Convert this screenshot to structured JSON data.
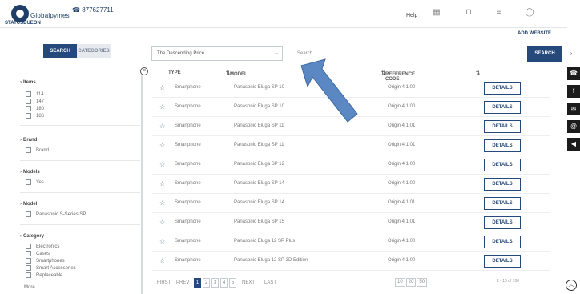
{
  "header": {
    "brand": "Globalpymes",
    "phone": "☎ 877627711",
    "breadcrumb": "STATUSBUEON",
    "help_label": "Help",
    "icons": [
      "grid-icon",
      "cart-icon",
      "bell-icon",
      "user-icon"
    ],
    "link_label": "ADD WEBSITE"
  },
  "tabs": [
    {
      "label": "SEARCH",
      "active": true
    },
    {
      "label": "CATEGORIES",
      "active": false
    }
  ],
  "toolbar": {
    "select_value": "The Descending Price",
    "search_value": "Search",
    "search_button": "SEARCH"
  },
  "sidebar": {
    "groups": [
      {
        "title": "Items",
        "options": [
          "114",
          "147",
          "180",
          "186"
        ]
      },
      {
        "title": "Brand",
        "options": [
          "Brand"
        ]
      },
      {
        "title": "Models",
        "options": [
          "Yes"
        ]
      },
      {
        "title": "Model",
        "options": [
          "Panasonic S-Series SP"
        ]
      },
      {
        "title": "Category",
        "options": [
          "Electronics",
          "Cases",
          "Smartphones",
          "Smart Accessories",
          "Replaceable"
        ]
      }
    ],
    "more": "More"
  },
  "table": {
    "headers": [
      "TYPE",
      "MODEL",
      "REFERENCE CODE"
    ],
    "rows": [
      {
        "type": "Smartphone",
        "model": "Panasonic Eluga SP 10",
        "code": "Origin 4.1.00",
        "action": "DETAILS"
      },
      {
        "type": "Smartphone",
        "model": "Panasonic Eluga SP 10",
        "code": "Origin 4.1.00",
        "action": "DETAILS"
      },
      {
        "type": "Smartphone",
        "model": "Panasonic Eluga SP 11",
        "code": "Origin 4.1.01",
        "action": "DETAILS"
      },
      {
        "type": "Smartphone",
        "model": "Panasonic Eluga SP 11",
        "code": "Origin 4.1.01",
        "action": "DETAILS"
      },
      {
        "type": "Smartphone",
        "model": "Panasonic Eluga SP 12",
        "code": "Origin 4.1.00",
        "action": "DETAILS"
      },
      {
        "type": "Smartphone",
        "model": "Panasonic Eluga SP 14",
        "code": "Origin 4.1.00",
        "action": "DETAILS"
      },
      {
        "type": "Smartphone",
        "model": "Panasonic Eluga SP 14",
        "code": "Origin 4.1.01",
        "action": "DETAILS"
      },
      {
        "type": "Smartphone",
        "model": "Panasonic Eluga SP 15",
        "code": "Origin 4.1.01",
        "action": "DETAILS"
      },
      {
        "type": "Smartphone",
        "model": "Panasonic Eluga 12 SP Plus",
        "code": "Origin 4.1.00",
        "action": "DETAILS"
      },
      {
        "type": "Smartphone",
        "model": "Panasonic Eluga 12 SP 3D Edition",
        "code": "Origin 4.1.00",
        "action": "DETAILS"
      }
    ]
  },
  "pagination": {
    "first": "FIRST",
    "prev": "PREV",
    "pages": [
      "1",
      "2",
      "3",
      "4",
      "5"
    ],
    "current": "1",
    "next": "NEXT",
    "last": "LAST",
    "per_page": [
      "10",
      "20",
      "50"
    ],
    "showing": "1 - 10 of 100"
  },
  "right_strip": {
    "icons": [
      "phone-icon",
      "facebook-icon",
      "chat-icon",
      "mail-icon",
      "megaphone-icon"
    ],
    "glyphs": [
      "☎",
      "f",
      "✉",
      "@",
      "◀"
    ]
  },
  "colors": {
    "primary": "#24497a",
    "arrow": "#5b87c2"
  }
}
